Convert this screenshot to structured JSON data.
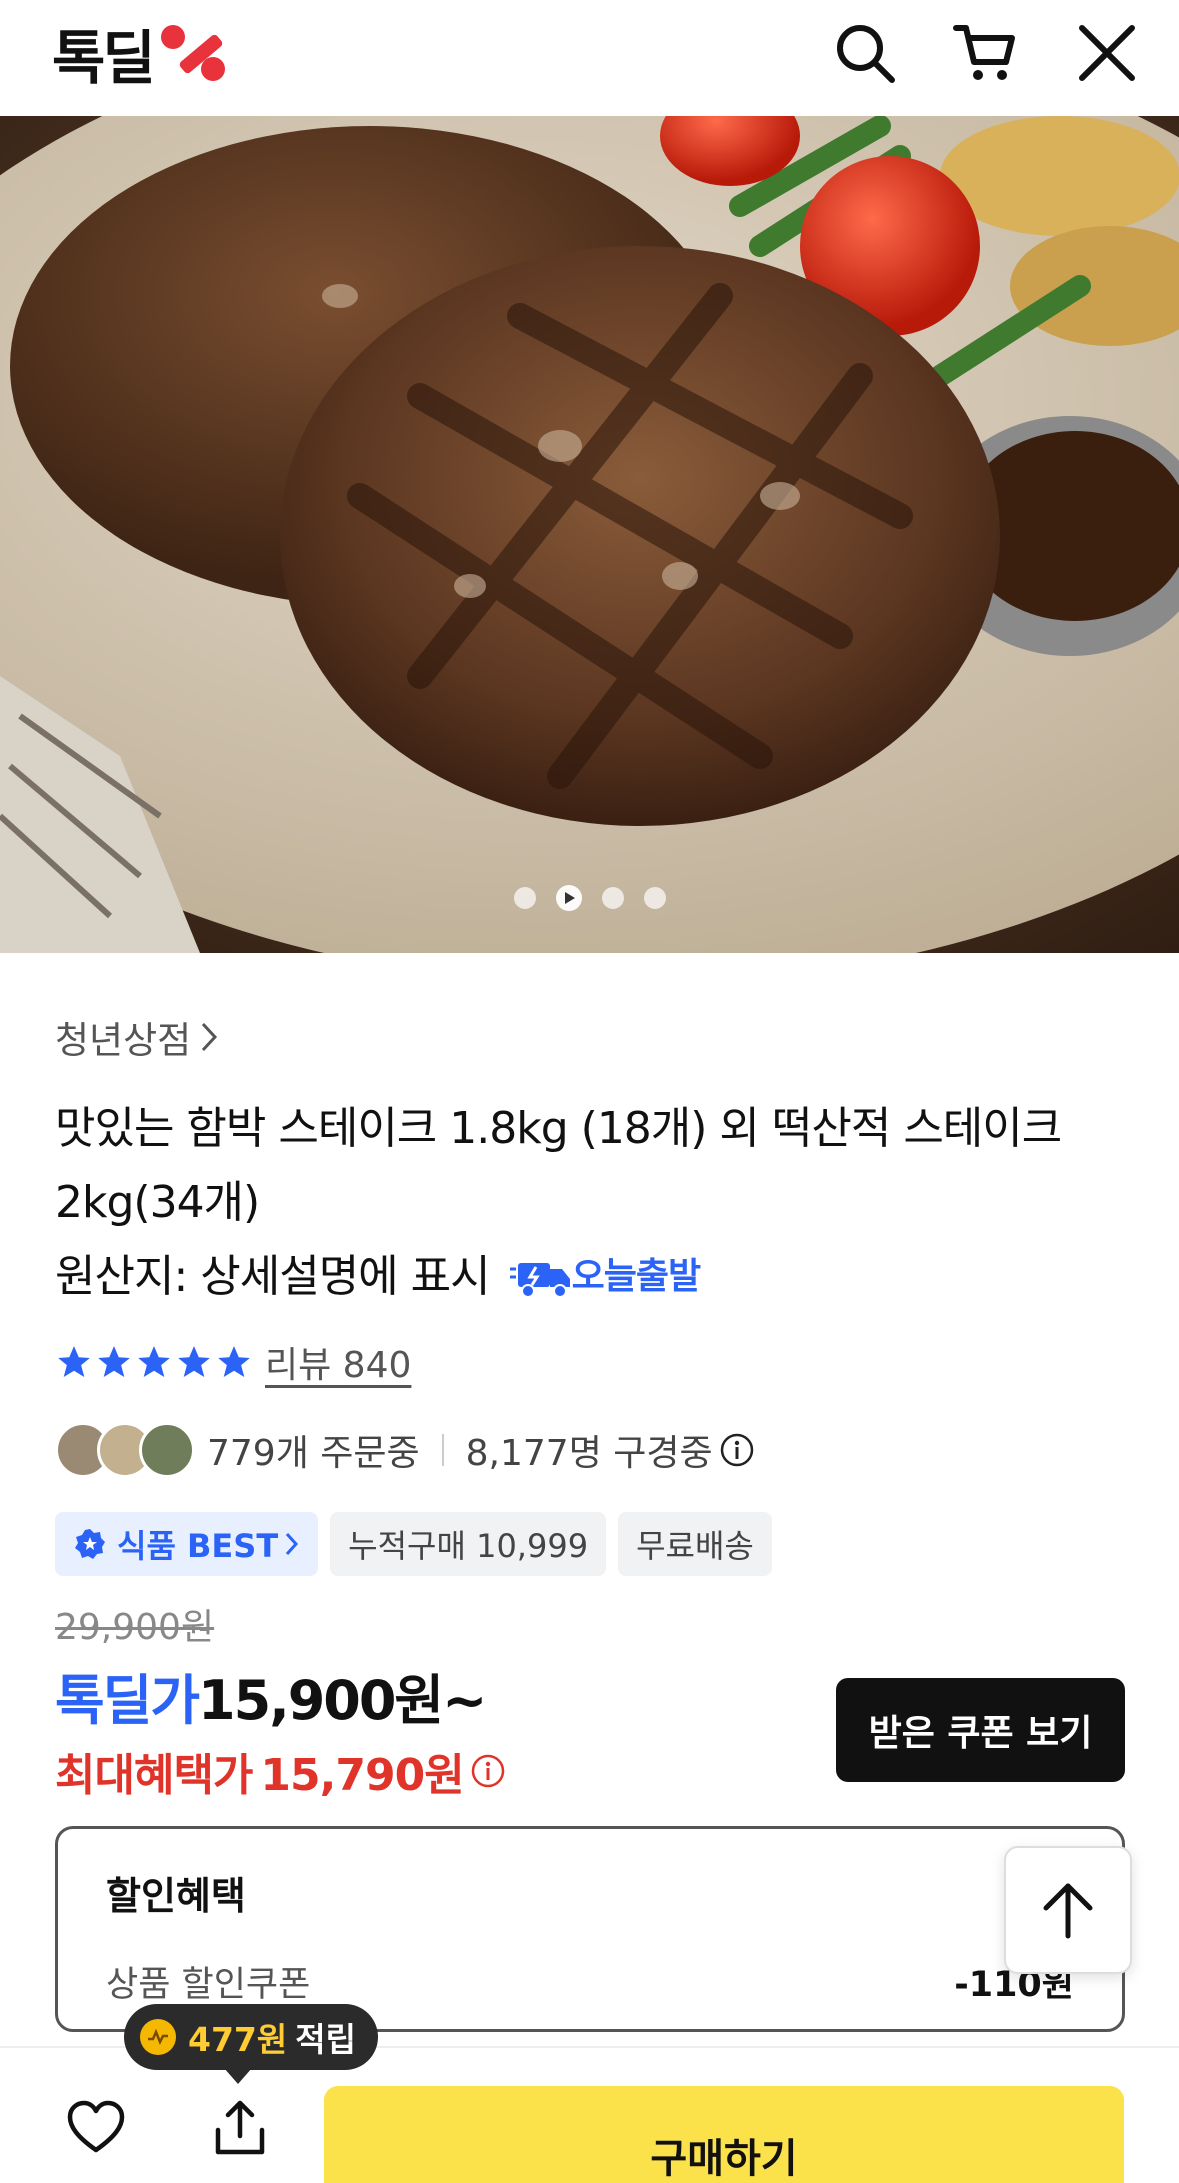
{
  "header": {
    "logo_text": "톡딜",
    "brand_color": "#e8323c"
  },
  "gallery": {
    "dot_count": 4,
    "active_index": 1
  },
  "product": {
    "seller": "청년상점",
    "title_line1": "맛있는 함박 스테이크 1.8kg (18개) 외 떡산적 스테이크",
    "title_line2": "2kg(34개)",
    "origin": "원산지: 상세설명에 표시",
    "shipping_badge": "오늘출발",
    "rating_stars": 5,
    "review_label": "리뷰 840",
    "ordering": "779개 주문중",
    "viewing": "8,177명 구경중",
    "tags": [
      {
        "label": "식품 BEST",
        "type": "best"
      },
      {
        "label": "누적구매 10,999",
        "type": "plain"
      },
      {
        "label": "무료배송",
        "type": "plain"
      }
    ]
  },
  "price": {
    "original": "29,900원",
    "deal_label": "톡딜가",
    "deal_price": "15,900원~",
    "max_label": "최대혜택가",
    "max_price": "15,790원",
    "coupon_button": "받은 쿠폰 보기"
  },
  "discount": {
    "title": "할인혜택",
    "row_label": "상품 할인쿠폰",
    "row_value": "-110원"
  },
  "bottom": {
    "points_amount": "477원",
    "points_suffix": "적립",
    "buy_button": "구매하기"
  },
  "colors": {
    "accent_blue": "#2a63f5",
    "accent_red": "#e0342a",
    "buy_yellow": "#fbe14a"
  }
}
